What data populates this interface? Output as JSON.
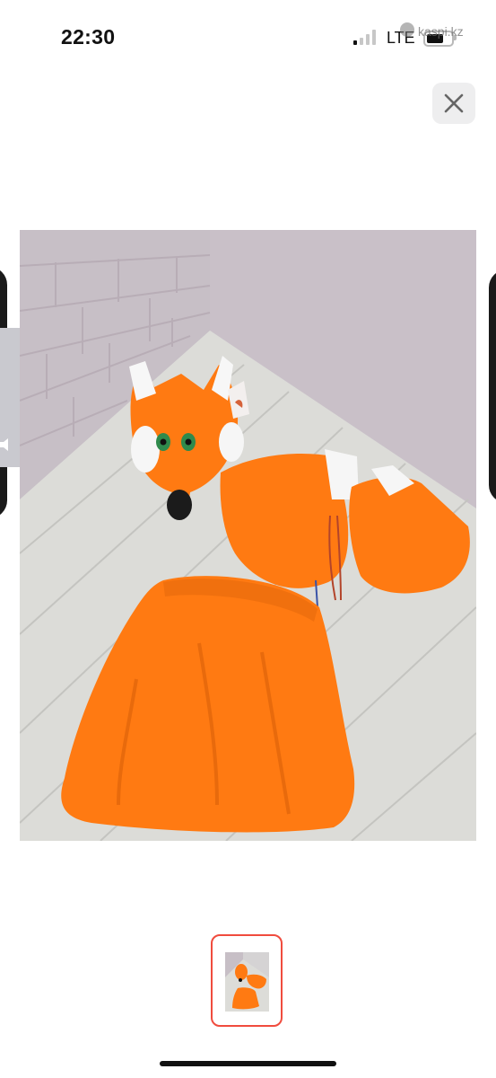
{
  "status_bar": {
    "time": "22:30",
    "network": "LTE",
    "signal_bars_active": 1,
    "watermark": "kaspi.kz"
  },
  "viewer": {
    "close_icon": "close-icon",
    "thumbnail_selected_color": "#f04c3e"
  },
  "colors": {
    "fur_orange": "#ff7a12",
    "floor": "#dcdcd8",
    "wall": "#c9c1c7"
  }
}
